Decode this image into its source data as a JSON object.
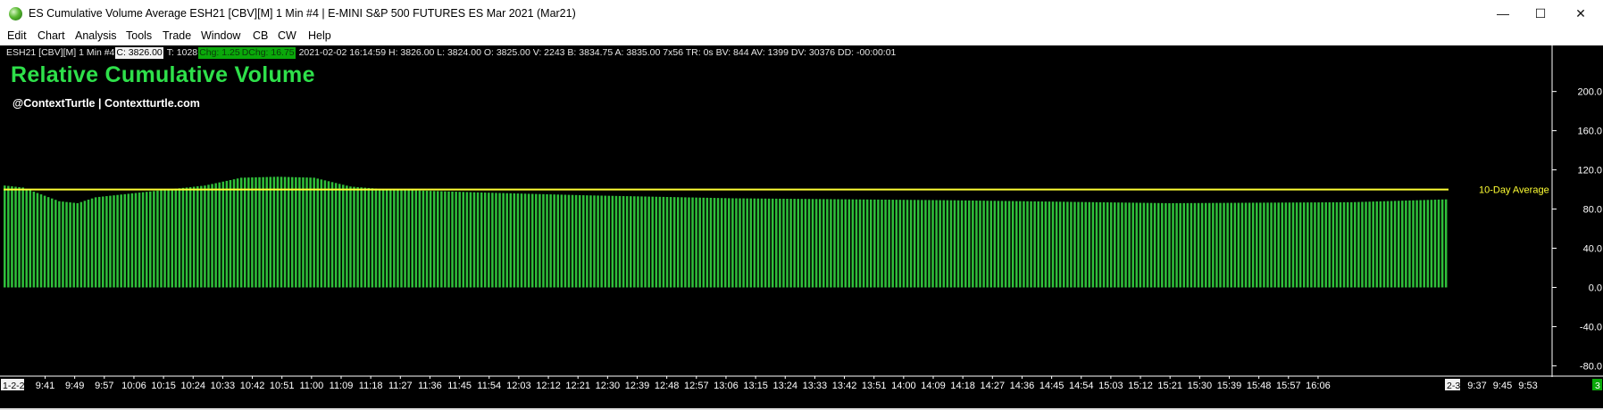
{
  "window": {
    "title": "ES Cumulative Volume Average ESH21 [CBV][M]  1 Min   #4 | E-MINI S&P 500 FUTURES ES Mar 2021 (Mar21)",
    "minimize_glyph": "—",
    "maximize_glyph": "☐",
    "close_glyph": "✕",
    "app_icon": "globe-icon"
  },
  "menu": [
    "Edit",
    "Chart",
    "Analysis",
    "Tools",
    "Trade",
    "Window",
    "CB",
    "CW",
    "Help"
  ],
  "status_line": {
    "symbol": "ESH21 [CBV][M]  1 Min   #4",
    "close": "C: 3826.00",
    "ticks": "T: 1028",
    "change": "Chg: 1.25",
    "day_change": "DChg: 16.75",
    "details": "2021-02-02 16:14:59 H: 3826.00 L: 3824.00 O: 3825.00 V: 2243 B: 3834.75 A: 3835.00 7x56 TR: 0s BV: 844 AV: 1399 DV: 30376 DD: -00:00:01"
  },
  "overlay": {
    "title": "Relative Cumulative Volume",
    "subtitle": "@ContextTurtle | Contextturtle.com"
  },
  "colors": {
    "background": "#000000",
    "bars": "#2fbf3a",
    "average_line": "#ffff33",
    "title": "#2ee04a",
    "axis_text": "#ffffff"
  },
  "chart_data": {
    "type": "bar",
    "y_ticks": [
      "200.0",
      "160.0",
      "120.0",
      "80.0",
      "40.0",
      "0.0",
      "-40.0",
      "-80.0"
    ],
    "ylim": [
      -86,
      247
    ],
    "reference_line": {
      "label": "10-Day Average",
      "value": 100
    },
    "x_start_label": "1-2-2",
    "x_end_label": "2-3",
    "x_labels": [
      "9:41",
      "9:49",
      "9:57",
      "10:06",
      "10:15",
      "10:24",
      "10:33",
      "10:42",
      "10:51",
      "11:00",
      "11:09",
      "11:18",
      "11:27",
      "11:36",
      "11:45",
      "11:54",
      "12:03",
      "12:12",
      "12:21",
      "12:30",
      "12:39",
      "12:48",
      "12:57",
      "13:06",
      "13:15",
      "13:24",
      "13:33",
      "13:42",
      "13:51",
      "14:00",
      "14:09",
      "14:18",
      "14:27",
      "14:36",
      "14:45",
      "14:54",
      "15:03",
      "15:12",
      "15:21",
      "15:30",
      "15:39",
      "15:48",
      "15:57",
      "16:06"
    ],
    "x_labels_after": [
      "9:37",
      "9:45",
      "9:53"
    ],
    "corner_badge": "3",
    "series_profile": {
      "bar_count": 397,
      "anchors": [
        [
          0,
          104
        ],
        [
          5,
          102
        ],
        [
          10,
          95
        ],
        [
          15,
          88
        ],
        [
          20,
          86
        ],
        [
          25,
          92
        ],
        [
          35,
          96
        ],
        [
          45,
          100
        ],
        [
          55,
          104
        ],
        [
          65,
          112
        ],
        [
          75,
          113
        ],
        [
          85,
          112
        ],
        [
          95,
          103
        ],
        [
          105,
          100
        ],
        [
          130,
          97
        ],
        [
          160,
          94
        ],
        [
          200,
          91
        ],
        [
          260,
          89
        ],
        [
          320,
          86
        ],
        [
          370,
          87
        ],
        [
          397,
          90
        ]
      ]
    }
  }
}
